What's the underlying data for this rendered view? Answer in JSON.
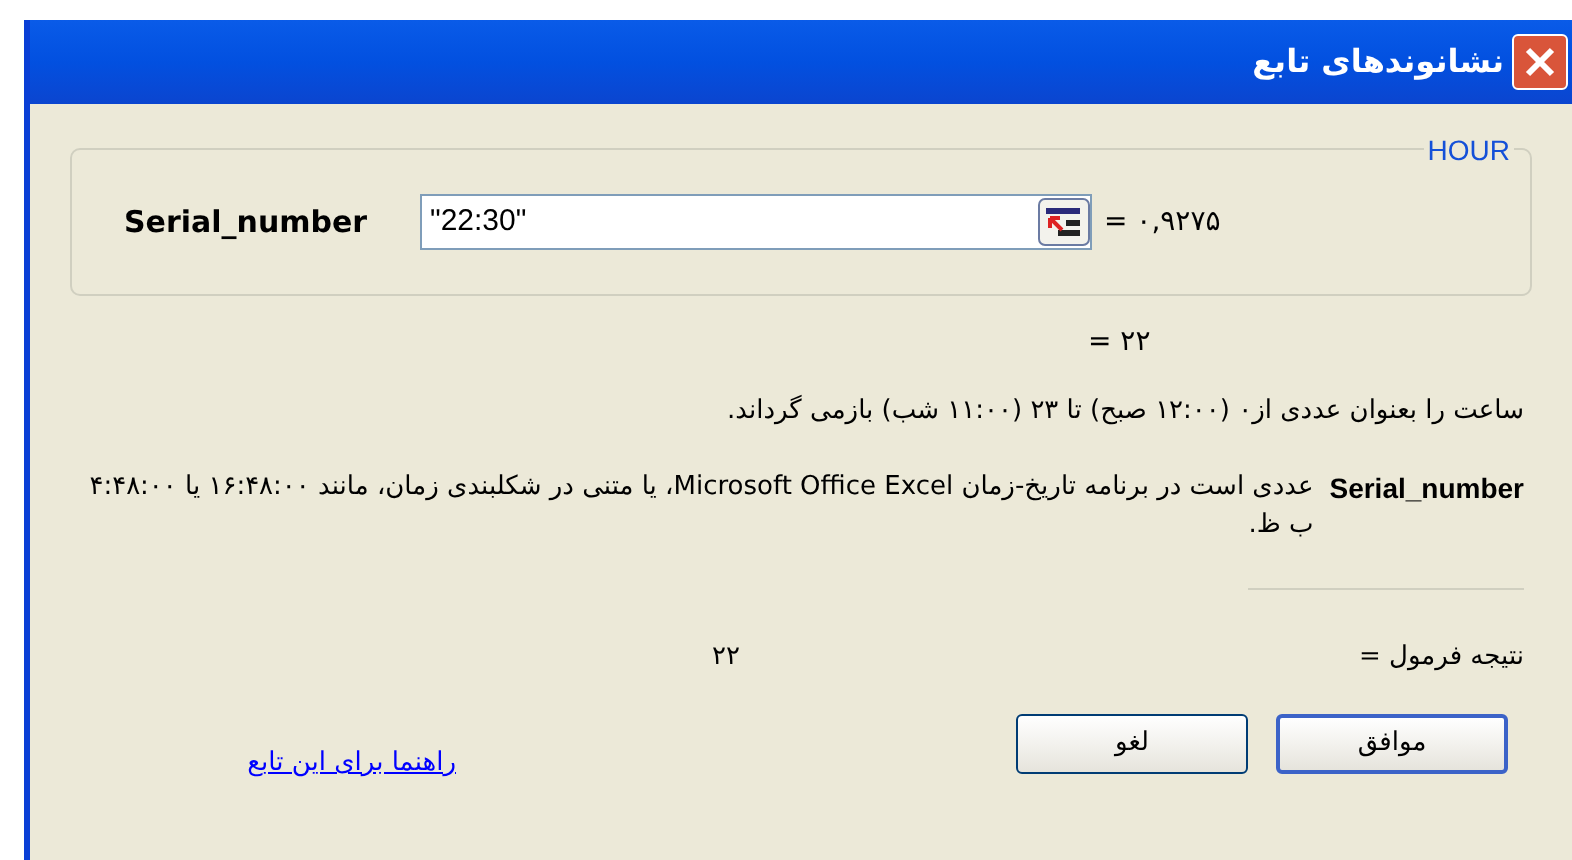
{
  "window": {
    "title": "نشانوندهای تابع"
  },
  "function_name": "HOUR",
  "arguments": [
    {
      "label": "Serial_number",
      "value": "\"22:30\"",
      "result": "= ۰,۹۲۷۵"
    }
  ],
  "formula_result_preview": "= ۲۲",
  "description": "ساعت را بعنوان عددی از۰ (۱۲:۰۰ صبح) تا ۲۳ (۱۱:۰۰ شب) بازمی گرداند.",
  "argument_help": {
    "name": "Serial_number",
    "text": "عددی است در برنامه تاریخ-زمان Microsoft Office Excel، یا متنی در شکلبندی زمان، مانند ۱۶:۴۸:۰۰ یا ۴:۴۸:۰۰ ب ظ."
  },
  "formula_result": {
    "label": "نتیجه فرمول =",
    "value": "۲۲"
  },
  "help_link": "راهنما برای این تابع",
  "buttons": [
    "موافق",
    "لغو"
  ]
}
